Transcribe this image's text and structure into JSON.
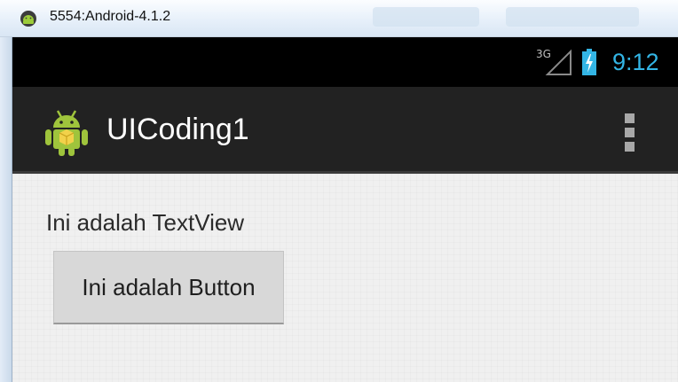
{
  "emulator": {
    "window_title": "5554:Android-4.1.2",
    "icon": "android-emulator-icon"
  },
  "status_bar": {
    "network_type": "3G",
    "time": "9:12",
    "signal_icon": "signal-strength-icon",
    "battery_icon": "battery-charging-icon",
    "clock_color": "#33b5e5"
  },
  "action_bar": {
    "app_title": "UICoding1",
    "app_icon": "android-robot-icon",
    "overflow_icon": "overflow-menu-icon",
    "background_color": "#222222"
  },
  "content": {
    "textview_text": "Ini adalah TextView",
    "button_label": "Ini adalah Button"
  }
}
